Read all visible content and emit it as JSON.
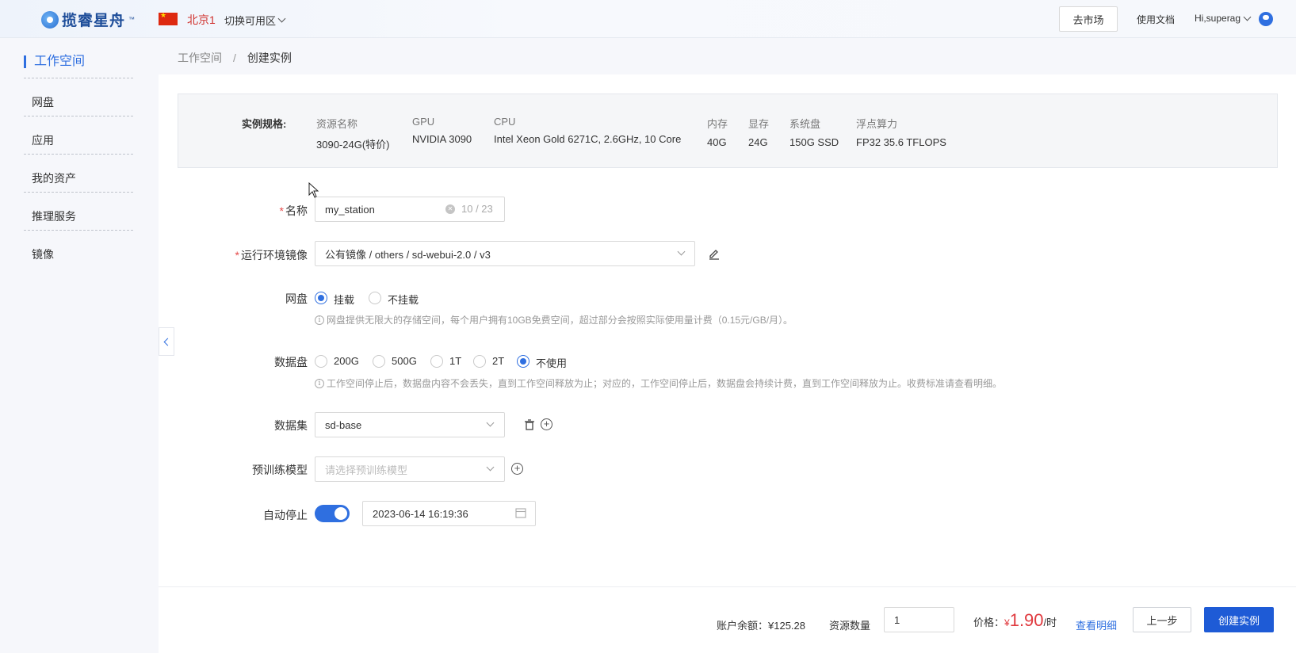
{
  "header": {
    "logo_text": "揽睿星舟",
    "region": "北京1",
    "switch_zone": "切换可用区",
    "market_button": "去市场",
    "docs_link": "使用文档",
    "user_greeting": "Hi,superag"
  },
  "sidebar": {
    "title": "工作空间",
    "items": [
      {
        "label": "网盘"
      },
      {
        "label": "应用"
      },
      {
        "label": "我的资产"
      },
      {
        "label": "推理服务"
      },
      {
        "label": "镜像"
      }
    ]
  },
  "breadcrumb": {
    "root": "工作空间",
    "separator": "/",
    "current": "创建实例"
  },
  "spec": {
    "label": "实例规格:",
    "columns": [
      {
        "header": "资源名称",
        "value": "3090-24G(特价)"
      },
      {
        "header": "GPU",
        "value": "NVIDIA 3090"
      },
      {
        "header": "CPU",
        "value": "Intel Xeon Gold 6271C, 2.6GHz, 10 Core"
      },
      {
        "header": "内存",
        "value": "40G"
      },
      {
        "header": "显存",
        "value": "24G"
      },
      {
        "header": "系统盘",
        "value": "150G SSD"
      },
      {
        "header": "浮点算力",
        "value": "FP32 35.6 TFLOPS"
      }
    ]
  },
  "form": {
    "required_mark": "*",
    "name": {
      "label": "名称",
      "value": "my_station",
      "count": "10 / 23"
    },
    "image": {
      "label": "运行环境镜像",
      "value": "公有镜像 / others / sd-webui-2.0 / v3"
    },
    "netdisk": {
      "label": "网盘",
      "options": [
        "挂载",
        "不挂载"
      ],
      "selected": "挂载",
      "hint": "网盘提供无限大的存储空间，每个用户拥有10GB免费空间，超过部分会按照实际使用量计费（0.15元/GB/月）。"
    },
    "datadisk": {
      "label": "数据盘",
      "options": [
        "200G",
        "500G",
        "1T",
        "2T",
        "不使用"
      ],
      "selected": "不使用",
      "hint": "工作空间停止后，数据盘内容不会丢失，直到工作空间释放为止；对应的，工作空间停止后，数据盘会持续计费，直到工作空间释放为止。收费标准请查看明细。"
    },
    "dataset": {
      "label": "数据集",
      "value": "sd-base"
    },
    "pretrained": {
      "label": "预训练模型",
      "placeholder": "请选择预训练模型"
    },
    "autostop": {
      "label": "自动停止",
      "enabled": true,
      "datetime": "2023-06-14 16:19:36"
    }
  },
  "footer": {
    "balance": "账户余额：¥125.28",
    "quantity_label": "资源数量",
    "quantity_value": "1",
    "price_label": "价格：",
    "price_currency": "¥",
    "price_value": "1.90",
    "price_unit": "/时",
    "detail_link": "查看明细",
    "prev_button": "上一步",
    "create_button": "创建实例"
  },
  "colors": {
    "accent": "#2f6fe0",
    "price": "#e0393e",
    "required": "#e54b4b"
  }
}
